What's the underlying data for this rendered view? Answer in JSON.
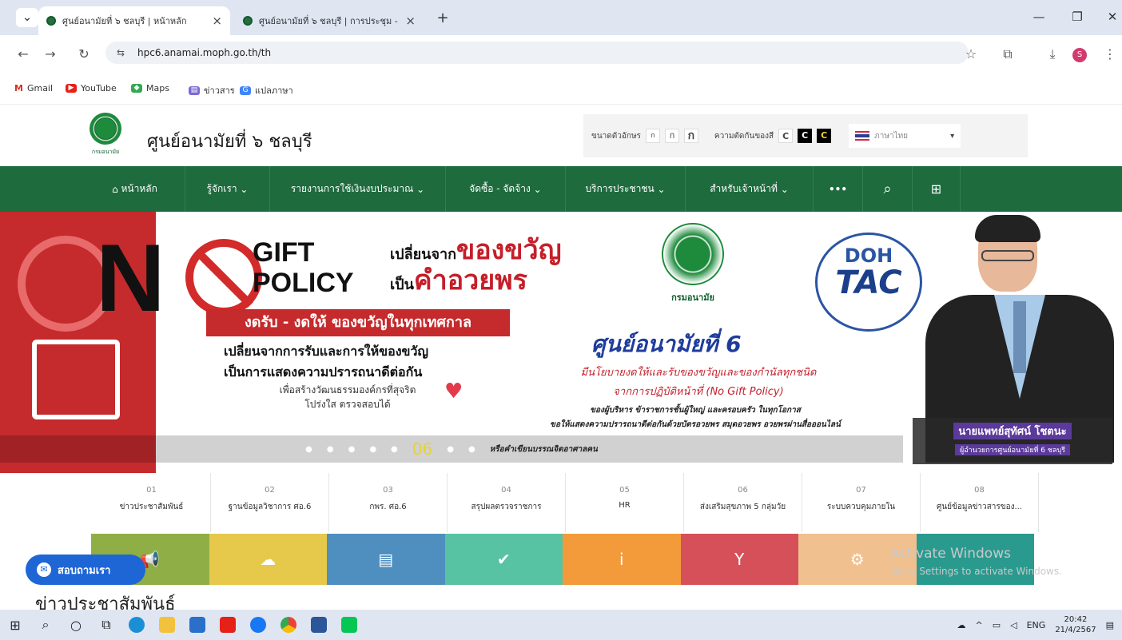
{
  "browser": {
    "tabs": [
      {
        "title": "ศูนย์อนามัยที่ ๖ ชลบุรี | หน้าหลัก",
        "active": true
      },
      {
        "title": "ศูนย์อนามัยที่ ๖ ชลบุรี | การประชุม -",
        "active": false
      }
    ],
    "new_tab": "+",
    "url": "hpc6.anamai.moph.go.th/th",
    "bookmarks": [
      "Gmail",
      "YouTube",
      "Maps",
      "ข่าวสาร",
      "แปลภาษา"
    ],
    "profile_initial": "S"
  },
  "site": {
    "title": "ศูนย์อนามัยที่ ๖ ชลบุรี",
    "logo_caption": "กรมอนามัย",
    "font_size_label": "ขนาดตัวอักษร",
    "font_sizes": [
      "ก",
      "ก",
      "ก"
    ],
    "contrast_label": "ความตัดกันของสี",
    "contrast_options": [
      "C",
      "C",
      "C"
    ],
    "language": "ภาษาไทย"
  },
  "nav": [
    "หน้าหลัก",
    "รู้จักเรา",
    "รายงานการใช้เงินงบประมาณ",
    "จัดซื้อ - จัดจ้าง",
    "บริการประชาชน",
    "สำหรับเจ้าหน้าที่",
    "•••"
  ],
  "banner": {
    "n_letter": "N",
    "gift": "GIFT",
    "policy": "POLICY",
    "change_from": "เปลี่ยนจาก",
    "gift_word": "ของขวัญ",
    "to": "เป็น",
    "blessing": "คำอวยพร",
    "red_bar": "งดรับ - งดให้ ของขวัญในทุกเทศกาล",
    "line1": "เปลี่ยนจากการรับและการให้ของขวัญ",
    "line2": "เป็นการแสดงความปรารถนาดีต่อกัน",
    "line3": "เพื่อสร้างวัฒนธรรมองค์กรที่สุจริต",
    "line4": "โปร่งใส ตรวจสอบได้",
    "doh_caption": "กรมอนามัย",
    "doh_tac_1": "DOH",
    "doh_tac_2": "TAC",
    "center_title": "ศูนย์อนามัยที่ 6",
    "policy_line1": "มีนโยบายงดให้และรับของขวัญและของกำนัลทุกชนิด",
    "policy_line2": "จากการปฏิบัติหน้าที่ (No Gift Policy)",
    "policy_line3": "ของผู้บริหาร ข้าราชการชั้นผู้ใหญ่ และครอบครัว ในทุกโอกาส",
    "policy_line4": "ขอให้แสดงความปรารถนาดีต่อกันด้วยบัตรอวยพร สมุดอวยพร อวยพรผ่านสื่อออนไลน์",
    "policy_line5": "หรือคำเขียนบรรณจิตอาศาลคน",
    "person_name": "นายแพทย์สุทัศน์ โชตนะ",
    "person_position": "ผู้อำนวยการศูนย์อนามัยที่ 6 ชลบุรี",
    "slide_current": "06",
    "dots_before": 5,
    "dots_after": 2
  },
  "quick_links": [
    {
      "num": "01",
      "label": "ข่าวประชาสัมพันธ์"
    },
    {
      "num": "02",
      "label": "ฐานข้อมูลวิชาการ ศอ.6"
    },
    {
      "num": "03",
      "label": "กพร. ศอ.6"
    },
    {
      "num": "04",
      "label": "สรุปผลตรวจราชการ"
    },
    {
      "num": "05",
      "label": "HR"
    },
    {
      "num": "06",
      "label": "ส่งเสริมสุขภาพ 5 กลุ่มวัย"
    },
    {
      "num": "07",
      "label": "ระบบควบคุมภายใน"
    },
    {
      "num": "08",
      "label": "ศูนย์ข้อมูลข่าวสารของ..."
    }
  ],
  "tiles_colors": [
    "#8fae45",
    "#e6c84a",
    "#4f8fc0",
    "#58c3a3",
    "#f39a3b",
    "#d6505a",
    "#f0c08f",
    "#2a9a8f"
  ],
  "tile_icons": [
    "📢",
    "☁",
    "▤",
    "✔",
    "i",
    "Y",
    "⚙",
    ""
  ],
  "chat_button": "สอบถามเรา",
  "activate": {
    "line1": "Activate Windows",
    "line2": "Go to Settings to activate Windows."
  },
  "news_heading": "ข่าวประชาสัมพันธ์",
  "taskbar": {
    "lang": "ENG",
    "time": "20:42",
    "date": "21/4/2567"
  }
}
